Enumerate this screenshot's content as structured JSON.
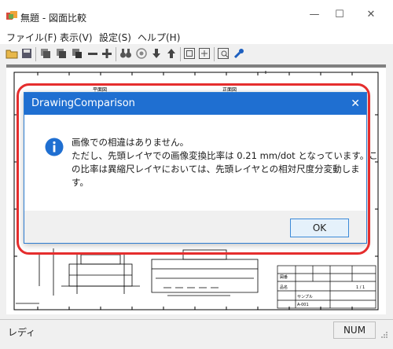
{
  "window": {
    "title": "無題 - 図面比較",
    "minimize": "—",
    "maximize": "☐",
    "close": "✕"
  },
  "menu": [
    "ファイル(F)",
    "表示(V)",
    "設定(S)",
    "ヘルプ(H)"
  ],
  "toolbar": {
    "icons": [
      "open-folder-icon",
      "save-icon",
      "layer-icon",
      "layer-add-icon",
      "layer-remove-icon",
      "minus-icon",
      "plus-icon",
      "binoculars-icon",
      "target-icon",
      "arrow-down-icon",
      "arrow-up-icon",
      "zoom-fit-icon",
      "zoom-window-icon",
      "compare-icon",
      "wrench-icon"
    ]
  },
  "drawing": {
    "left_header_label": "平面図",
    "right_header_label": "正面図",
    "title_block": [
      "図番",
      "品名",
      "サンプル",
      "A-001",
      "1 / 1"
    ]
  },
  "dialog": {
    "title": "DrawingComparison",
    "close": "✕",
    "message_line1": "画像での相違はありません。",
    "message_line2": "ただし、先頭レイヤでの画像変換比率は 0.21 mm/dot となっています。こ",
    "message_line3": "の比率は異縮尺レイヤにおいては、先頭レイヤとの相対尺度分変動しま",
    "message_line4": "す。",
    "ok_label": "OK",
    "icon": "info-icon",
    "accent": "#1f6fd1"
  },
  "status": {
    "left": "レディ",
    "right": "NUM"
  },
  "highlight_color": "#e52d2d"
}
